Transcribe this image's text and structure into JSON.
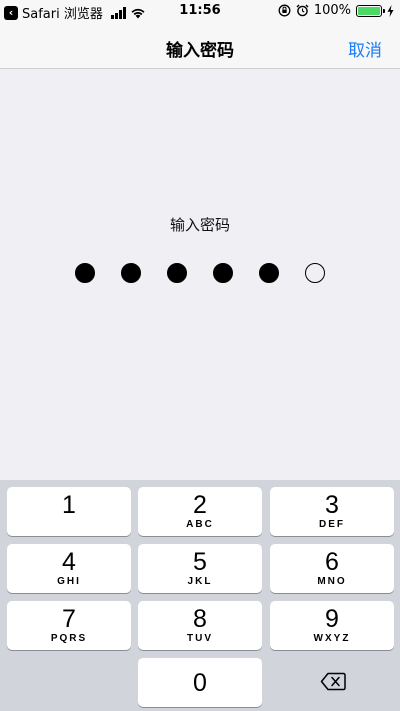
{
  "status_bar": {
    "back_app": "Safari 浏览器",
    "time": "11:56",
    "battery_percent": "100%",
    "battery_level": 1.0,
    "battery_color": "#4cd964"
  },
  "nav": {
    "title": "输入密码",
    "cancel_label": "取消",
    "accent_color": "#1a7cf6"
  },
  "passcode": {
    "prompt": "输入密码",
    "length": 6,
    "filled": 5
  },
  "keypad": {
    "keys": [
      {
        "num": "1",
        "letters": ""
      },
      {
        "num": "2",
        "letters": "ABC"
      },
      {
        "num": "3",
        "letters": "DEF"
      },
      {
        "num": "4",
        "letters": "GHI"
      },
      {
        "num": "5",
        "letters": "JKL"
      },
      {
        "num": "6",
        "letters": "MNO"
      },
      {
        "num": "7",
        "letters": "PQRS"
      },
      {
        "num": "8",
        "letters": "TUV"
      },
      {
        "num": "9",
        "letters": "WXYZ"
      },
      {
        "num": "0",
        "letters": ""
      }
    ],
    "delete_icon": "backspace-icon"
  }
}
